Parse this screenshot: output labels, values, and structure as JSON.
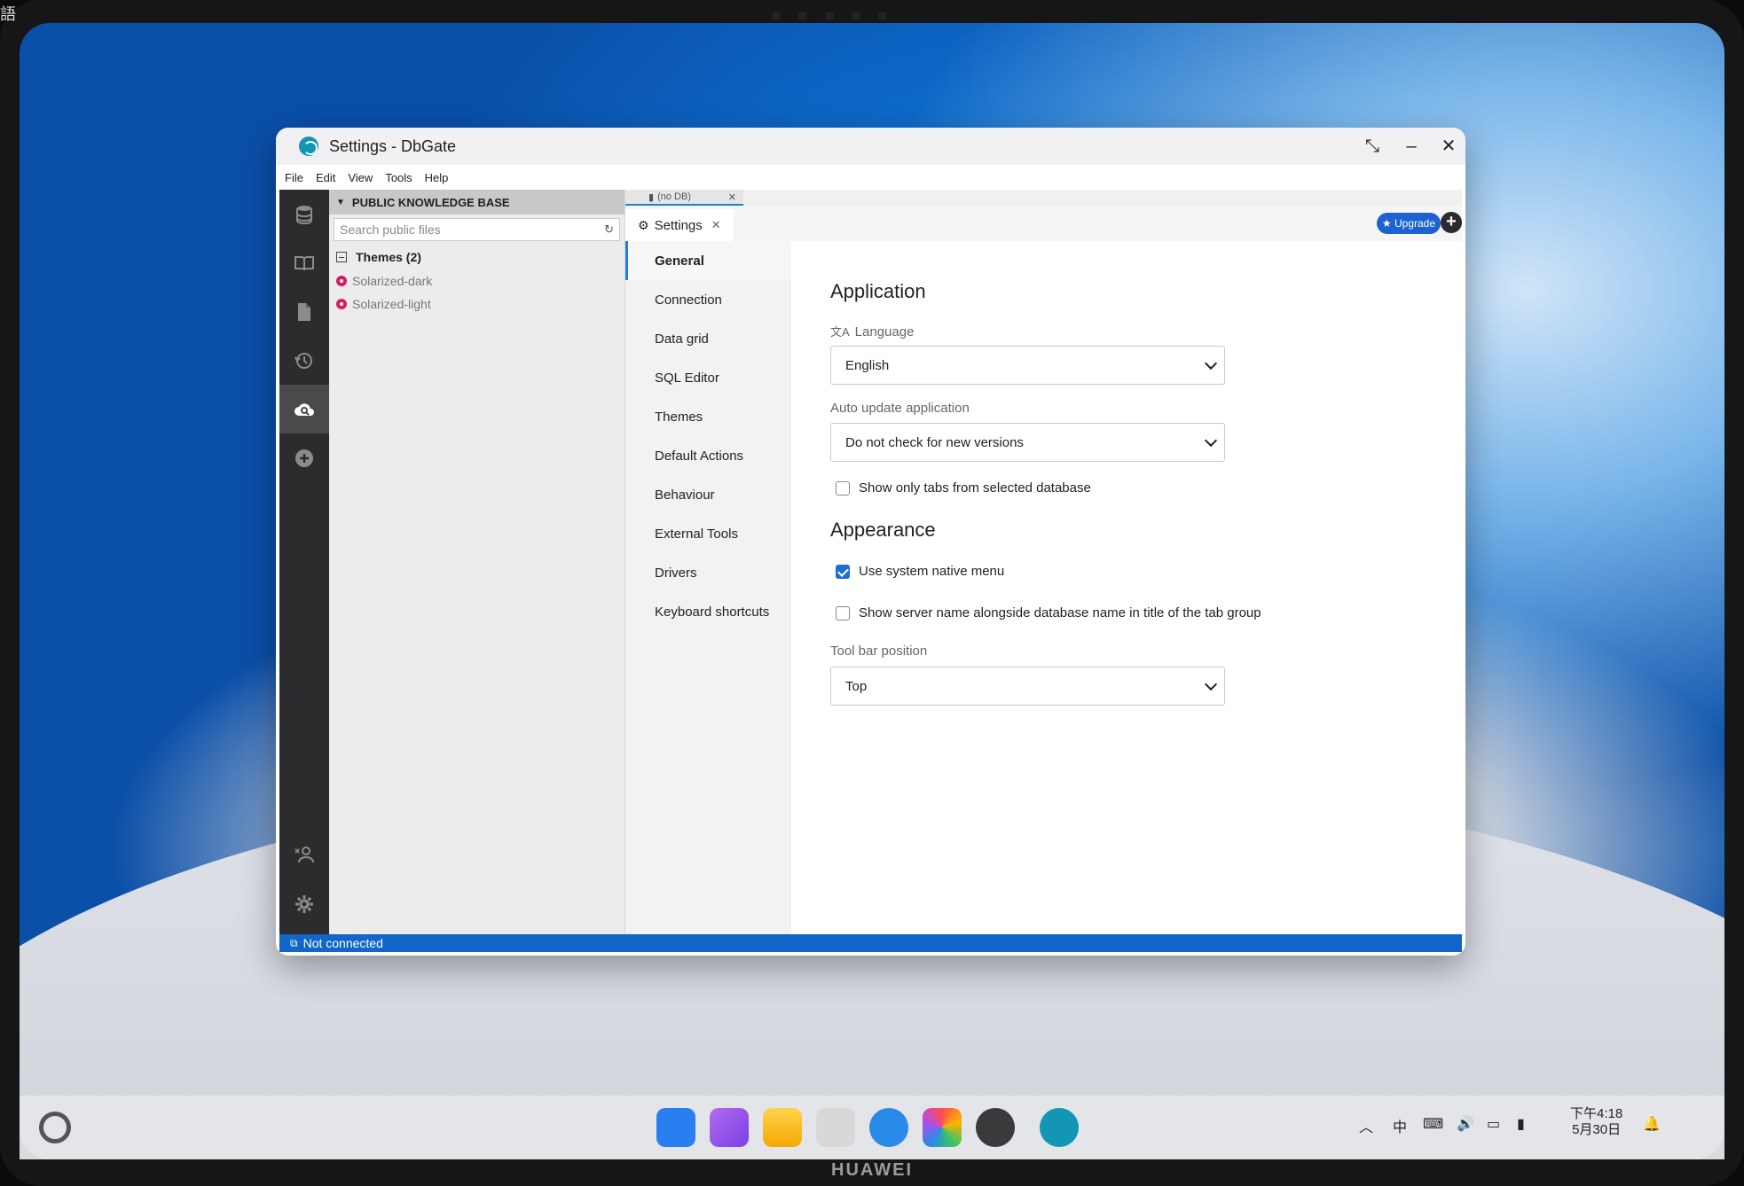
{
  "device": {
    "brand": "HUAWEI",
    "corner_text": "語"
  },
  "window": {
    "title": "Settings - DbGate"
  },
  "menu": [
    "File",
    "Edit",
    "View",
    "Tools",
    "Help"
  ],
  "iconbar": [
    {
      "icon": "database-icon"
    },
    {
      "icon": "book-icon"
    },
    {
      "icon": "file-icon"
    },
    {
      "icon": "history-icon"
    },
    {
      "icon": "cloud-search-icon",
      "active": true
    },
    {
      "icon": "plus-circle-icon"
    }
  ],
  "sidebar": {
    "header": "PUBLIC KNOWLEDGE BASE",
    "search_placeholder": "Search public files",
    "group": "Themes (2)",
    "items": [
      "Solarized-dark",
      "Solarized-light"
    ]
  },
  "tabs": {
    "db_tab": "(no DB)",
    "settings_tab": "Settings",
    "upgrade": "★ Upgrade"
  },
  "nav": [
    "General",
    "Connection",
    "Data grid",
    "SQL Editor",
    "Themes",
    "Default Actions",
    "Behaviour",
    "External Tools",
    "Drivers",
    "Keyboard shortcuts"
  ],
  "form": {
    "application_heading": "Application",
    "language_label": "Language",
    "language_value": "English",
    "auto_update_label": "Auto update application",
    "auto_update_value": "Do not check for new versions",
    "show_tabs_label": "Show only tabs from selected database",
    "show_tabs_checked": false,
    "appearance_heading": "Appearance",
    "native_menu_label": "Use system native menu",
    "native_menu_checked": true,
    "server_name_label": "Show server name alongside database name in title of the tab group",
    "server_name_checked": false,
    "toolbar_label": "Tool bar position",
    "toolbar_value": "Top"
  },
  "status": {
    "text": "Not connected"
  },
  "taskbar": {
    "time": "下午4:18",
    "date": "5月30日",
    "ime": "中"
  },
  "colors": {
    "accent": "#1e7fd6",
    "status_bar": "#1166c8",
    "upgrade": "#1e62d0"
  }
}
